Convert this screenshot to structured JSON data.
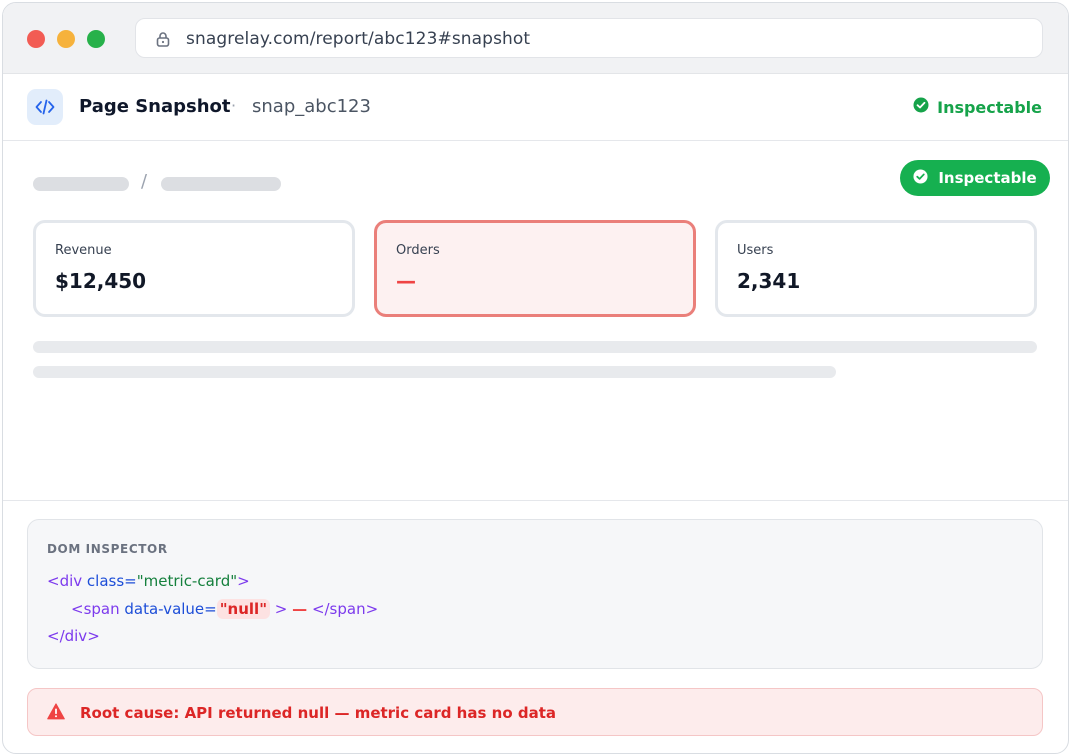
{
  "browser": {
    "url": "snagrelay.com/report/abc123#snapshot"
  },
  "header": {
    "title": "Page Snapshot",
    "separator": "·",
    "snapshot_id": "snap_abc123",
    "status": "Inspectable"
  },
  "page": {
    "breadcrumb_separator": "/",
    "status_pill": "Inspectable",
    "metrics": [
      {
        "label": "Revenue",
        "value": "$12,450"
      },
      {
        "label": "Orders",
        "value": "—"
      },
      {
        "label": "Users",
        "value": "2,341"
      }
    ]
  },
  "inspector": {
    "title": "DOM INSPECTOR",
    "line1": {
      "open": "<div",
      "attr": "class=",
      "value": "\"metric-card\"",
      "close": ">"
    },
    "line2": {
      "open": "<span",
      "attr": "data-value=",
      "value": "\"null\"",
      "gt": ">",
      "content": "—",
      "close": "</span>"
    },
    "line3": {
      "close": "</div>"
    }
  },
  "root_cause": {
    "text": "Root cause: API returned null — metric card has no data"
  },
  "colors": {
    "success": "#16b050",
    "error": "#ef4444",
    "accent_blue": "#1d4ed8"
  }
}
